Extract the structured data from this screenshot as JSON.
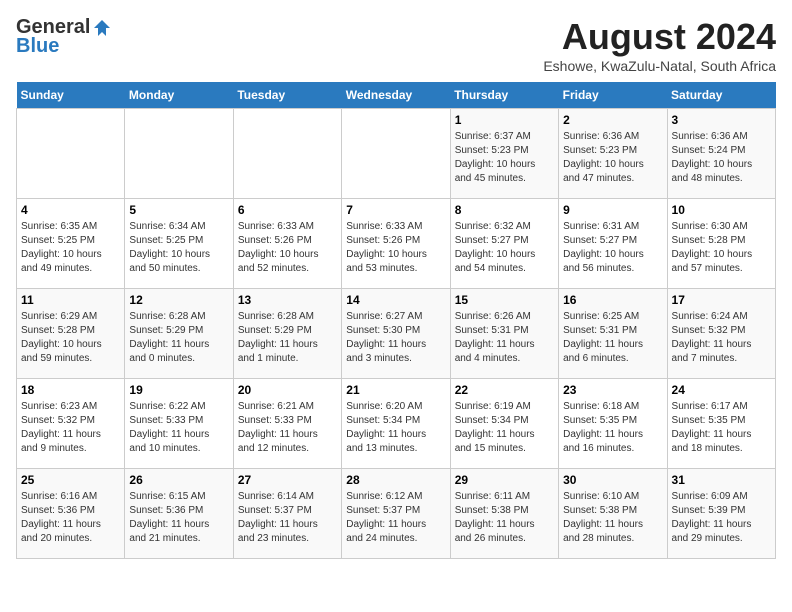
{
  "logo": {
    "general": "General",
    "blue": "Blue"
  },
  "title": "August 2024",
  "subtitle": "Eshowe, KwaZulu-Natal, South Africa",
  "weekdays": [
    "Sunday",
    "Monday",
    "Tuesday",
    "Wednesday",
    "Thursday",
    "Friday",
    "Saturday"
  ],
  "weeks": [
    [
      {
        "day": "",
        "info": ""
      },
      {
        "day": "",
        "info": ""
      },
      {
        "day": "",
        "info": ""
      },
      {
        "day": "",
        "info": ""
      },
      {
        "day": "1",
        "info": "Sunrise: 6:37 AM\nSunset: 5:23 PM\nDaylight: 10 hours\nand 45 minutes."
      },
      {
        "day": "2",
        "info": "Sunrise: 6:36 AM\nSunset: 5:23 PM\nDaylight: 10 hours\nand 47 minutes."
      },
      {
        "day": "3",
        "info": "Sunrise: 6:36 AM\nSunset: 5:24 PM\nDaylight: 10 hours\nand 48 minutes."
      }
    ],
    [
      {
        "day": "4",
        "info": "Sunrise: 6:35 AM\nSunset: 5:25 PM\nDaylight: 10 hours\nand 49 minutes."
      },
      {
        "day": "5",
        "info": "Sunrise: 6:34 AM\nSunset: 5:25 PM\nDaylight: 10 hours\nand 50 minutes."
      },
      {
        "day": "6",
        "info": "Sunrise: 6:33 AM\nSunset: 5:26 PM\nDaylight: 10 hours\nand 52 minutes."
      },
      {
        "day": "7",
        "info": "Sunrise: 6:33 AM\nSunset: 5:26 PM\nDaylight: 10 hours\nand 53 minutes."
      },
      {
        "day": "8",
        "info": "Sunrise: 6:32 AM\nSunset: 5:27 PM\nDaylight: 10 hours\nand 54 minutes."
      },
      {
        "day": "9",
        "info": "Sunrise: 6:31 AM\nSunset: 5:27 PM\nDaylight: 10 hours\nand 56 minutes."
      },
      {
        "day": "10",
        "info": "Sunrise: 6:30 AM\nSunset: 5:28 PM\nDaylight: 10 hours\nand 57 minutes."
      }
    ],
    [
      {
        "day": "11",
        "info": "Sunrise: 6:29 AM\nSunset: 5:28 PM\nDaylight: 10 hours\nand 59 minutes."
      },
      {
        "day": "12",
        "info": "Sunrise: 6:28 AM\nSunset: 5:29 PM\nDaylight: 11 hours\nand 0 minutes."
      },
      {
        "day": "13",
        "info": "Sunrise: 6:28 AM\nSunset: 5:29 PM\nDaylight: 11 hours\nand 1 minute."
      },
      {
        "day": "14",
        "info": "Sunrise: 6:27 AM\nSunset: 5:30 PM\nDaylight: 11 hours\nand 3 minutes."
      },
      {
        "day": "15",
        "info": "Sunrise: 6:26 AM\nSunset: 5:31 PM\nDaylight: 11 hours\nand 4 minutes."
      },
      {
        "day": "16",
        "info": "Sunrise: 6:25 AM\nSunset: 5:31 PM\nDaylight: 11 hours\nand 6 minutes."
      },
      {
        "day": "17",
        "info": "Sunrise: 6:24 AM\nSunset: 5:32 PM\nDaylight: 11 hours\nand 7 minutes."
      }
    ],
    [
      {
        "day": "18",
        "info": "Sunrise: 6:23 AM\nSunset: 5:32 PM\nDaylight: 11 hours\nand 9 minutes."
      },
      {
        "day": "19",
        "info": "Sunrise: 6:22 AM\nSunset: 5:33 PM\nDaylight: 11 hours\nand 10 minutes."
      },
      {
        "day": "20",
        "info": "Sunrise: 6:21 AM\nSunset: 5:33 PM\nDaylight: 11 hours\nand 12 minutes."
      },
      {
        "day": "21",
        "info": "Sunrise: 6:20 AM\nSunset: 5:34 PM\nDaylight: 11 hours\nand 13 minutes."
      },
      {
        "day": "22",
        "info": "Sunrise: 6:19 AM\nSunset: 5:34 PM\nDaylight: 11 hours\nand 15 minutes."
      },
      {
        "day": "23",
        "info": "Sunrise: 6:18 AM\nSunset: 5:35 PM\nDaylight: 11 hours\nand 16 minutes."
      },
      {
        "day": "24",
        "info": "Sunrise: 6:17 AM\nSunset: 5:35 PM\nDaylight: 11 hours\nand 18 minutes."
      }
    ],
    [
      {
        "day": "25",
        "info": "Sunrise: 6:16 AM\nSunset: 5:36 PM\nDaylight: 11 hours\nand 20 minutes."
      },
      {
        "day": "26",
        "info": "Sunrise: 6:15 AM\nSunset: 5:36 PM\nDaylight: 11 hours\nand 21 minutes."
      },
      {
        "day": "27",
        "info": "Sunrise: 6:14 AM\nSunset: 5:37 PM\nDaylight: 11 hours\nand 23 minutes."
      },
      {
        "day": "28",
        "info": "Sunrise: 6:12 AM\nSunset: 5:37 PM\nDaylight: 11 hours\nand 24 minutes."
      },
      {
        "day": "29",
        "info": "Sunrise: 6:11 AM\nSunset: 5:38 PM\nDaylight: 11 hours\nand 26 minutes."
      },
      {
        "day": "30",
        "info": "Sunrise: 6:10 AM\nSunset: 5:38 PM\nDaylight: 11 hours\nand 28 minutes."
      },
      {
        "day": "31",
        "info": "Sunrise: 6:09 AM\nSunset: 5:39 PM\nDaylight: 11 hours\nand 29 minutes."
      }
    ]
  ]
}
